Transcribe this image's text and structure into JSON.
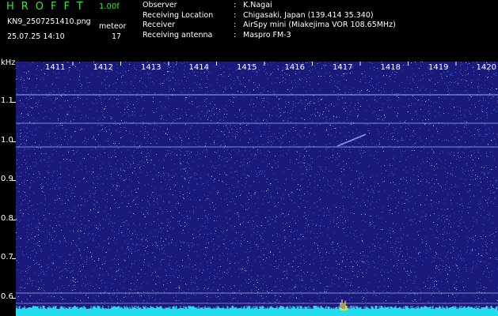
{
  "header": {
    "app_title": "HROFFT",
    "version": "1.00f",
    "filename": "KN9_2507251410.png",
    "meteor_label": "meteor",
    "datetime": "25.07.25 14:10",
    "meteor_count": "17",
    "info": [
      {
        "label": "Observer",
        "value": "K.Nagai"
      },
      {
        "label": "Receiving Location",
        "value": "Chigasaki, Japan (139.414 35.340)"
      },
      {
        "label": "Receiver",
        "value": "AirSpy mini (Miakejima VOR 108.65MHz)"
      },
      {
        "label": "Receiving antenna",
        "value": "Maspro FM-3"
      }
    ]
  },
  "spectrogram": {
    "unit": "kHz",
    "x_ticks": [
      "1411",
      "1412",
      "1413",
      "1414",
      "1415",
      "1416",
      "1417",
      "1418",
      "1419",
      "1420"
    ],
    "y_ticks": [
      "1.1",
      "1.0",
      "0.9",
      "0.8",
      "0.7",
      "0.6"
    ],
    "background_color": "#1a1a7a",
    "noise_color": "#5a78e6",
    "baseline_color": "#22ddee"
  }
}
